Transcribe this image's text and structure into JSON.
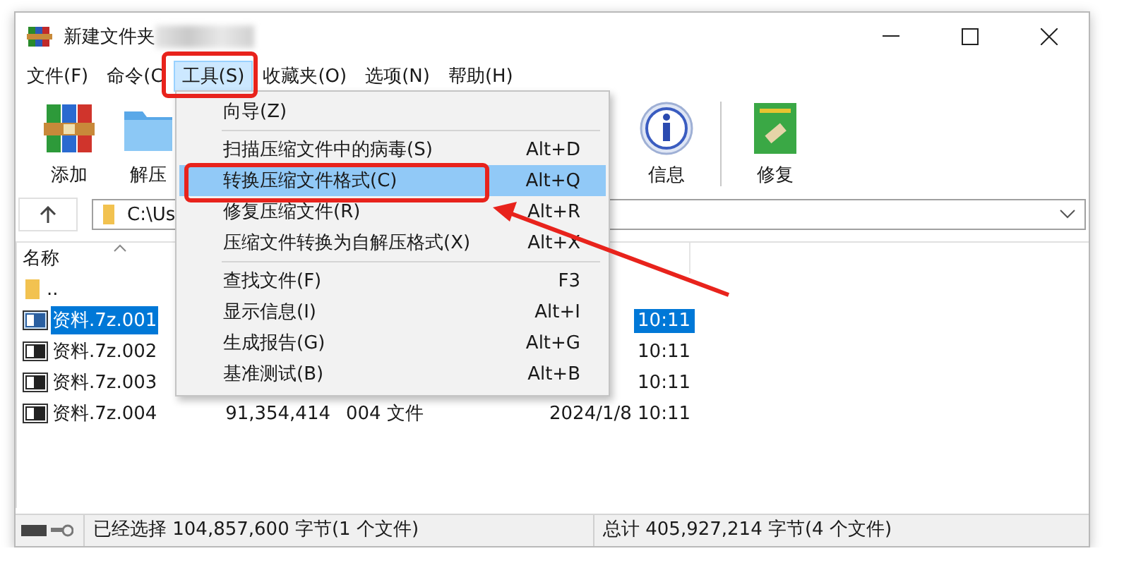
{
  "window": {
    "title": "新建文件夹"
  },
  "menu_bar": [
    {
      "label": "文件(F)",
      "selected": false
    },
    {
      "label": "命令(C",
      "selected": false
    },
    {
      "label": "工具(S)",
      "selected": true
    },
    {
      "label": "收藏夹(O)",
      "selected": false
    },
    {
      "label": "选项(N)",
      "selected": false
    },
    {
      "label": "帮助(H)",
      "selected": false
    }
  ],
  "toolbar": [
    {
      "label": "添加",
      "kind": "add"
    },
    {
      "label": "解压",
      "kind": "extract"
    },
    {
      "label": "信息",
      "kind": "info"
    },
    {
      "label": "修复",
      "kind": "repair"
    }
  ],
  "address": {
    "value": "C:\\Us"
  },
  "file_list": {
    "columns": [
      "名称"
    ],
    "rows": [
      {
        "name": "..",
        "kind": "folder",
        "selected": false
      },
      {
        "name": "资料.7z.001",
        "kind": "archive",
        "selected": true,
        "modified": "10:11"
      },
      {
        "name": "资料.7z.002",
        "kind": "archive",
        "selected": false,
        "modified": "10:11"
      },
      {
        "name": "资料.7z.003",
        "kind": "archive",
        "selected": false,
        "modified": "10:11"
      },
      {
        "name": "资料.7z.004",
        "kind": "archive",
        "selected": false,
        "size": "91,354,414",
        "type": "004 文件",
        "modified": "2024/1/8 10:11"
      }
    ]
  },
  "tools_menu": {
    "groups": [
      {
        "items": [
          {
            "label": "向导(Z)",
            "selected": false
          }
        ]
      },
      {
        "items": [
          {
            "label": "扫描压缩文件中的病毒(S)",
            "shortcut": "Alt+D",
            "selected": false
          },
          {
            "label": "转换压缩文件格式(C)",
            "shortcut": "Alt+Q",
            "selected": true
          },
          {
            "label": "修复压缩文件(R)",
            "shortcut": "Alt+R",
            "selected": false
          },
          {
            "label": "压缩文件转换为自解压格式(X)",
            "shortcut": "Alt+X",
            "selected": false
          }
        ]
      },
      {
        "items": [
          {
            "label": "查找文件(F)",
            "shortcut": "F3",
            "selected": false
          },
          {
            "label": "显示信息(I)",
            "shortcut": "Alt+I",
            "selected": false
          },
          {
            "label": "生成报告(G)",
            "shortcut": "Alt+G",
            "selected": false
          },
          {
            "label": "基准测试(B)",
            "shortcut": "Alt+B",
            "selected": false
          }
        ]
      }
    ]
  },
  "status_bar": {
    "left": "已经选择 104,857,600 字节(1 个文件)",
    "right": "总计 405,927,214 字节(4 个文件)"
  }
}
